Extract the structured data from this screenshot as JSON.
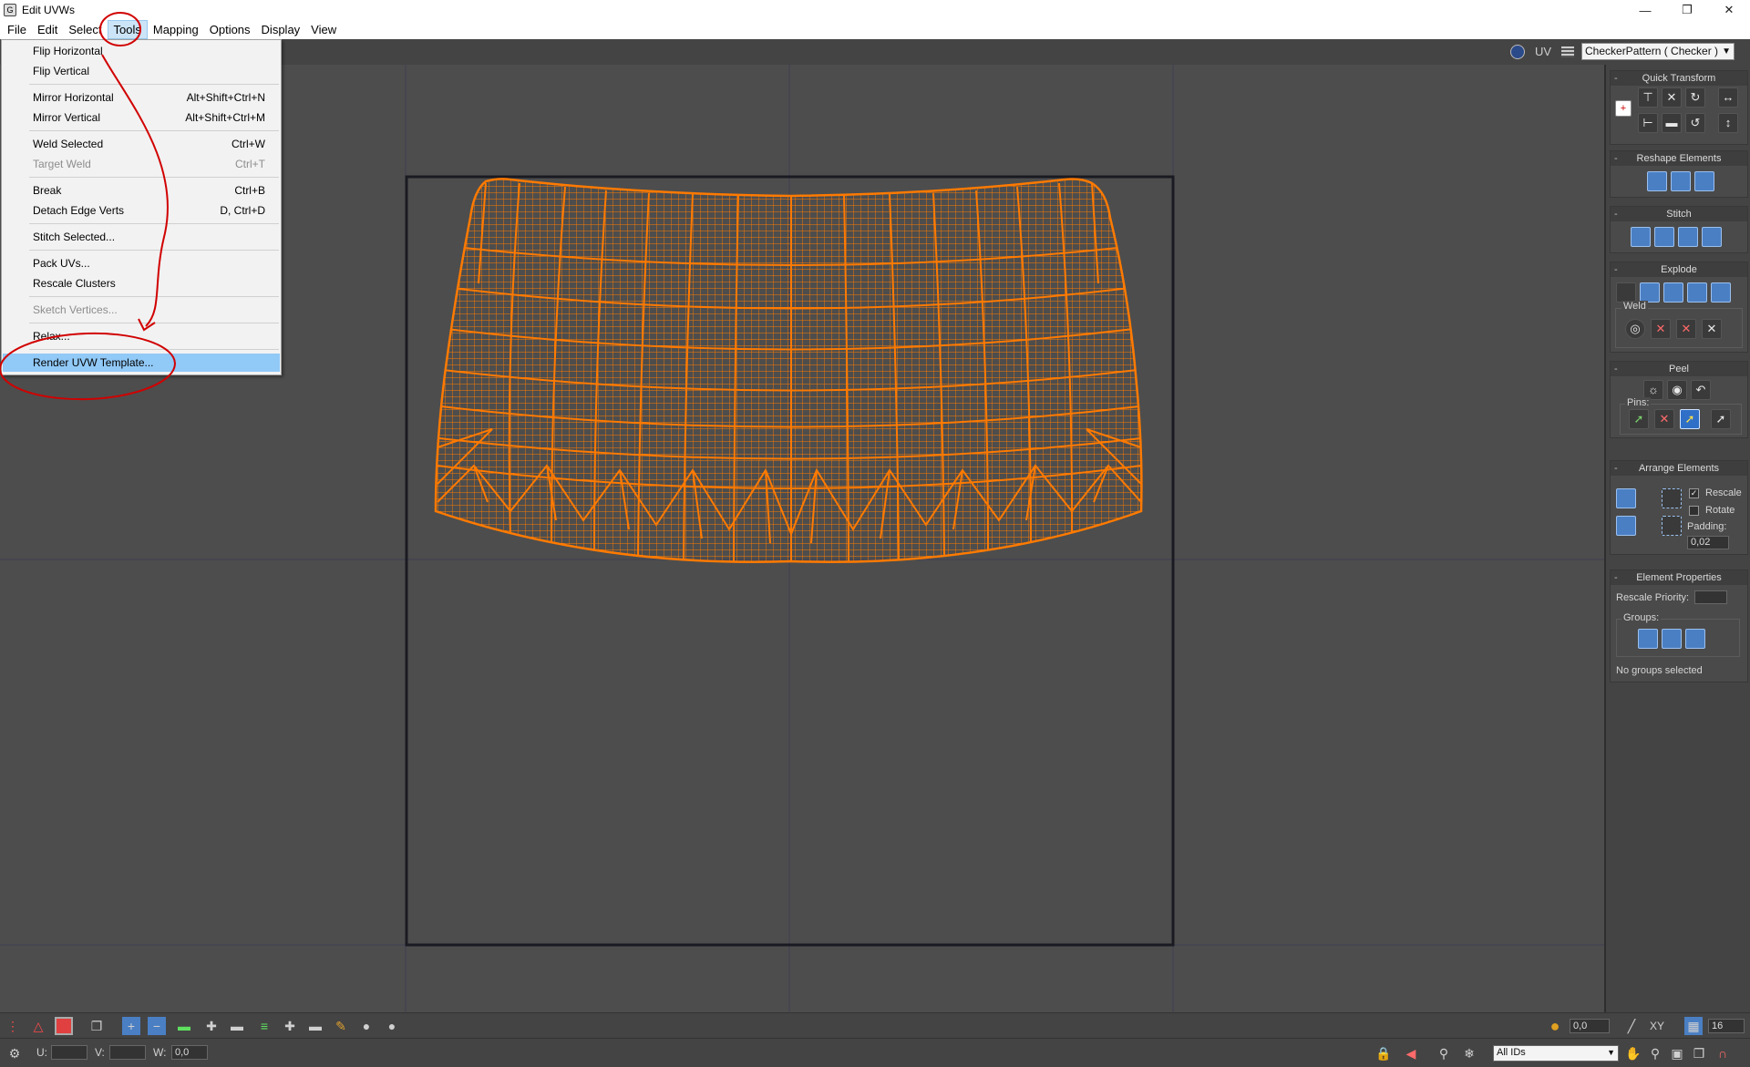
{
  "window": {
    "title": "Edit UVWs",
    "controls": [
      "minimize-icon",
      "restore-icon",
      "close-icon"
    ]
  },
  "menubar": {
    "items": [
      {
        "label": "File"
      },
      {
        "label": "Edit"
      },
      {
        "label": "Select"
      },
      {
        "label": "Tools"
      },
      {
        "label": "Mapping"
      },
      {
        "label": "Options"
      },
      {
        "label": "Display"
      },
      {
        "label": "View"
      }
    ],
    "active": "Tools"
  },
  "tools_menu": {
    "items": [
      {
        "label": "Flip Horizontal",
        "shortcut": ""
      },
      {
        "label": "Flip Vertical",
        "shortcut": ""
      },
      {
        "label": "Mirror Horizontal",
        "shortcut": "Alt+Shift+Ctrl+N"
      },
      {
        "label": "Mirror Vertical",
        "shortcut": "Alt+Shift+Ctrl+M"
      },
      {
        "label": "Weld Selected",
        "shortcut": "Ctrl+W"
      },
      {
        "label": "Target Weld",
        "shortcut": "Ctrl+T",
        "disabled": true
      },
      {
        "label": "Break",
        "shortcut": "Ctrl+B"
      },
      {
        "label": "Detach Edge Verts",
        "shortcut": "D, Ctrl+D"
      },
      {
        "label": "Stitch Selected...",
        "shortcut": ""
      },
      {
        "label": "Pack UVs...",
        "shortcut": ""
      },
      {
        "label": "Rescale Clusters",
        "shortcut": ""
      },
      {
        "label": "Sketch Vertices...",
        "shortcut": "",
        "disabled": true
      },
      {
        "label": "Relax...",
        "shortcut": ""
      },
      {
        "label": "Render UVW Template...",
        "shortcut": "",
        "highlighted": true
      }
    ]
  },
  "top_toolbar": {
    "uv_label": "UV",
    "texture_combo": "CheckerPattern  ( Checker )"
  },
  "right_panel": {
    "quick_transform": "Quick Transform",
    "reshape_elements": "Reshape Elements",
    "stitch": "Stitch",
    "explode": "Explode",
    "weld": "Weld",
    "peel": "Peel",
    "pins": "Pins:",
    "arrange_elements": "Arrange Elements",
    "rescale": "Rescale",
    "rotate": "Rotate",
    "padding_label": "Padding:",
    "padding_value": "0,02",
    "element_properties": "Element Properties",
    "rescale_priority": "Rescale Priority:",
    "groups": "Groups:",
    "no_groups": "No groups selected",
    "rescale_checked": true,
    "rotate_checked": false
  },
  "bottom_bar": {
    "u_label": "U:",
    "v_label": "V:",
    "w_label": "W:",
    "w_value": "0,0",
    "soft_value": "0,0",
    "xy_label": "XY",
    "grid_value": "16",
    "ids_combo": "All IDs"
  },
  "colors": {
    "wireframe": "#ff7a00",
    "viewport_bg": "#4d4d4d",
    "panel_bg": "#444444",
    "menu_highlight": "#91c9f7",
    "annotation": "#d10000"
  }
}
